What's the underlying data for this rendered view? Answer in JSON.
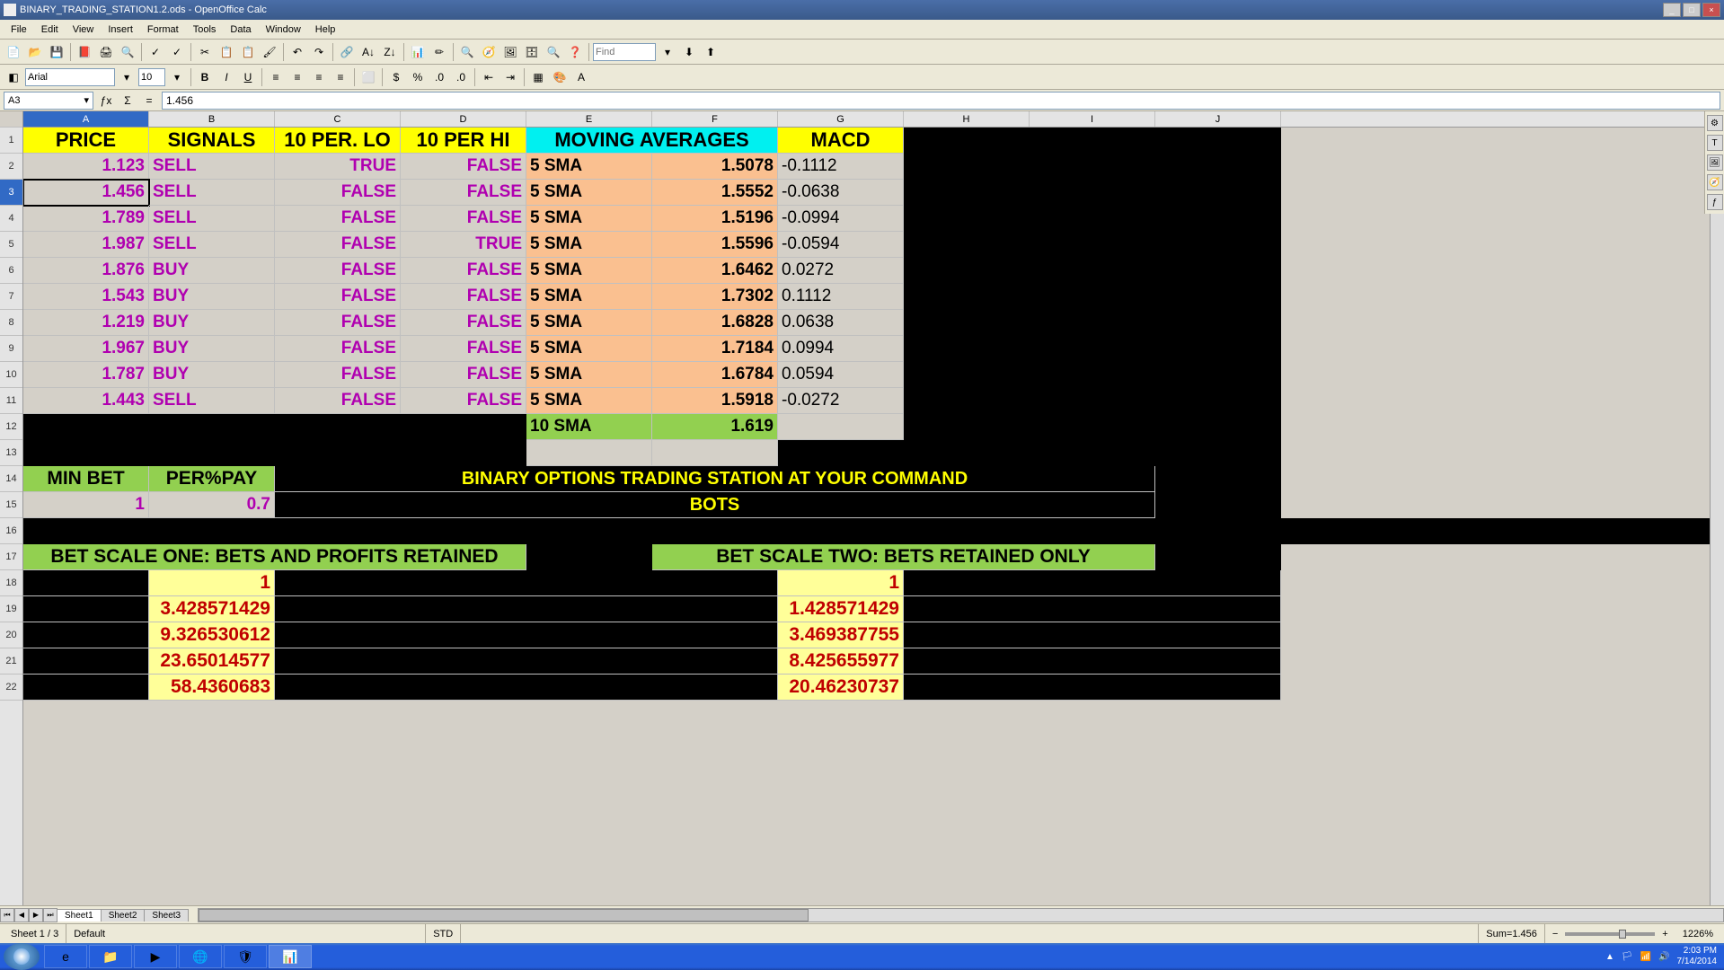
{
  "window": {
    "title": "BINARY_TRADING_STATION1.2.ods - OpenOffice Calc"
  },
  "menu": [
    "File",
    "Edit",
    "View",
    "Insert",
    "Format",
    "Tools",
    "Data",
    "Window",
    "Help"
  ],
  "find_placeholder": "Find",
  "font": {
    "name": "Arial",
    "size": "10"
  },
  "name_box": "A3",
  "formula": "1.456",
  "columns": [
    "A",
    "B",
    "C",
    "D",
    "E",
    "F",
    "G",
    "H",
    "I",
    "J"
  ],
  "headers": {
    "A": "PRICE",
    "B": "SIGNALS",
    "C": "10 PER. LO",
    "D": "10 PER HI",
    "EF": "MOVING AVERAGES",
    "G": "MACD"
  },
  "rows": [
    {
      "n": 2,
      "price": "1.123",
      "sig": "SELL",
      "lo": "TRUE",
      "hi": "FALSE",
      "ma": "5 SMA",
      "mav": "1.5078",
      "macd": "-0.1112"
    },
    {
      "n": 3,
      "price": "1.456",
      "sig": "SELL",
      "lo": "FALSE",
      "hi": "FALSE",
      "ma": "5 SMA",
      "mav": "1.5552",
      "macd": "-0.0638"
    },
    {
      "n": 4,
      "price": "1.789",
      "sig": "SELL",
      "lo": "FALSE",
      "hi": "FALSE",
      "ma": "5 SMA",
      "mav": "1.5196",
      "macd": "-0.0994"
    },
    {
      "n": 5,
      "price": "1.987",
      "sig": "SELL",
      "lo": "FALSE",
      "hi": "TRUE",
      "ma": "5 SMA",
      "mav": "1.5596",
      "macd": "-0.0594"
    },
    {
      "n": 6,
      "price": "1.876",
      "sig": "BUY",
      "lo": "FALSE",
      "hi": "FALSE",
      "ma": "5 SMA",
      "mav": "1.6462",
      "macd": "0.0272"
    },
    {
      "n": 7,
      "price": "1.543",
      "sig": "BUY",
      "lo": "FALSE",
      "hi": "FALSE",
      "ma": "5 SMA",
      "mav": "1.7302",
      "macd": "0.1112"
    },
    {
      "n": 8,
      "price": "1.219",
      "sig": "BUY",
      "lo": "FALSE",
      "hi": "FALSE",
      "ma": "5 SMA",
      "mav": "1.6828",
      "macd": "0.0638"
    },
    {
      "n": 9,
      "price": "1.967",
      "sig": "BUY",
      "lo": "FALSE",
      "hi": "FALSE",
      "ma": "5 SMA",
      "mav": "1.7184",
      "macd": "0.0994"
    },
    {
      "n": 10,
      "price": "1.787",
      "sig": "BUY",
      "lo": "FALSE",
      "hi": "FALSE",
      "ma": "5 SMA",
      "mav": "1.6784",
      "macd": "0.0594"
    },
    {
      "n": 11,
      "price": "1.443",
      "sig": "SELL",
      "lo": "FALSE",
      "hi": "FALSE",
      "ma": "5 SMA",
      "mav": "1.5918",
      "macd": "-0.0272"
    }
  ],
  "sma10": {
    "label": "10 SMA",
    "value": "1.619"
  },
  "row14": {
    "minbet": "MIN BET",
    "perpay": "PER%PAY",
    "cmd": "BINARY OPTIONS TRADING STATION AT YOUR COMMAND"
  },
  "row15": {
    "minbet_v": "1",
    "perpay_v": "0.7",
    "bots": "BOTS"
  },
  "row17": {
    "scale1": "BET SCALE ONE: BETS AND PROFITS RETAINED",
    "scale2": "BET SCALE TWO: BETS RETAINED ONLY"
  },
  "bets1": [
    "1",
    "3.428571429",
    "9.326530612",
    "23.65014577",
    "58.4360683"
  ],
  "bets2": [
    "1",
    "1.428571429",
    "3.469387755",
    "8.425655977",
    "20.46230737"
  ],
  "sheets": [
    "Sheet1",
    "Sheet2",
    "Sheet3"
  ],
  "status": {
    "sheet": "Sheet 1 / 3",
    "style": "Default",
    "mode": "STD",
    "sum": "Sum=1.456",
    "zoom": "1226%"
  },
  "systray": {
    "time": "2:03 PM",
    "date": "7/14/2014"
  }
}
